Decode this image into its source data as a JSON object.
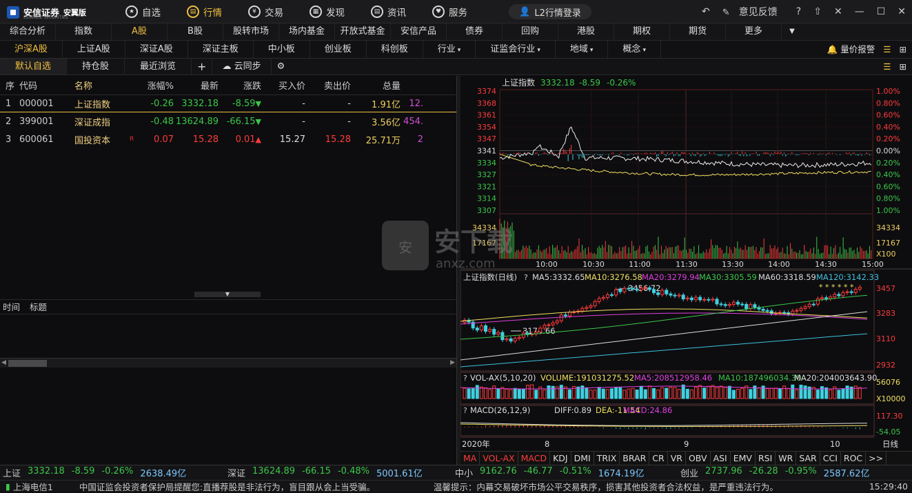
{
  "app": {
    "name": "安信证券",
    "sub": "ESSENCE SECURITIES",
    "edition": "安翼版"
  },
  "mainnav": [
    {
      "label": "自选",
      "icon": "★"
    },
    {
      "label": "行情",
      "icon": "▤",
      "active": true
    },
    {
      "label": "交易",
      "icon": "¥"
    },
    {
      "label": "发现",
      "icon": "▦"
    },
    {
      "label": "资讯",
      "icon": "▤"
    },
    {
      "label": "服务",
      "icon": "♥"
    }
  ],
  "l2_button": "L2行情登录",
  "window": {
    "feedback": "意见反馈"
  },
  "tabs1": [
    "综合分析",
    "指数",
    "A股",
    "B股",
    "股转市场",
    "场内基金",
    "开放式基金",
    "安信产品",
    "债券",
    "回购",
    "港股",
    "期权",
    "期货",
    "更多"
  ],
  "tabs2": [
    "沪深A股",
    "上证A股",
    "深证A股",
    "深证主板",
    "中小板",
    "创业板",
    "科创板",
    "行业",
    "证监会行业",
    "地域",
    "概念"
  ],
  "tabs2_alert": "量价报警",
  "tabs3": [
    "默认自选",
    "持仓股",
    "最近浏览"
  ],
  "tabs3_sync": "云同步",
  "table": {
    "headers": [
      "序",
      "代码",
      "名称",
      "涨幅%",
      "最新",
      "涨跌",
      "买入价",
      "卖出价",
      "总量"
    ],
    "rows": [
      {
        "seq": "1",
        "code": "000001",
        "name": "上证指数",
        "r": "",
        "pct": "-0.26",
        "last": "3332.18",
        "chg": "-8.59",
        "arrow": "▼",
        "bid": "-",
        "ask": "-",
        "vol": "1.91亿",
        "amt": "12.",
        "dir": "down"
      },
      {
        "seq": "2",
        "code": "399001",
        "name": "深证成指",
        "r": "",
        "pct": "-0.48",
        "last": "13624.89",
        "chg": "-66.15",
        "arrow": "▼",
        "bid": "-",
        "ask": "-",
        "vol": "3.56亿",
        "amt": "454.",
        "dir": "down"
      },
      {
        "seq": "3",
        "code": "600061",
        "name": "国投资本",
        "r": "R",
        "pct": "0.07",
        "last": "15.28",
        "chg": "0.01",
        "arrow": "▲",
        "bid": "15.27",
        "ask": "15.28",
        "vol": "25.71万",
        "amt": "2",
        "dir": "up"
      }
    ]
  },
  "news": {
    "time": "时间",
    "title": "标题"
  },
  "intraday": {
    "title": "上证指数",
    "last": "3332.18",
    "chg": "-8.59",
    "pct": "-0.26%",
    "price_ticks": [
      "3374",
      "3368",
      "3361",
      "3354",
      "3347",
      "3341",
      "3334",
      "3327",
      "3321",
      "3314",
      "3307"
    ],
    "pct_ticks": [
      "1.00%",
      "0.80%",
      "0.60%",
      "0.40%",
      "0.20%",
      "0.00%",
      "0.20%",
      "0.40%",
      "0.60%",
      "0.80%",
      "1.00%"
    ],
    "vol_ticks": [
      "34334",
      "17167",
      "X100"
    ],
    "vol_left": [
      "34334",
      "17167"
    ],
    "time_ticks": [
      "10:00",
      "10:30",
      "11:00",
      "11:30",
      "13:30",
      "14:00",
      "14:30",
      "15:00"
    ]
  },
  "kline": {
    "title": "上证指数(日线)",
    "ma5": "MA5:3332.65",
    "ma10": "MA10:3276.58",
    "ma20": "MA20:3279.94",
    "ma30": "MA30:3305.59",
    "ma60": "MA60:3318.59",
    "ma120": "MA120:3142.33",
    "high_label": "3456.72",
    "low_label": "3174.66",
    "ticks": [
      "3457",
      "3283",
      "3110",
      "2932"
    ],
    "stars": "* * * * * *"
  },
  "vol": {
    "title": "VOL-AX(5,10,20)",
    "volume": "VOLUME:191031275.52",
    "ma5": "MA5:208512958.46",
    "ma10": "MA10:187496034.30",
    "ma20": "MA20:204003643.90",
    "ticks": [
      "56076",
      "X10000"
    ]
  },
  "macd": {
    "title": "MACD(26,12,9)",
    "diff": "DIFF:0.89",
    "dea": "DEA:-11.54",
    "macd": "MACD:24.86",
    "ticks": [
      "117.30",
      "-54.05"
    ]
  },
  "date_axis": {
    "year": "2020年",
    "m8": "8",
    "m9": "9",
    "m10": "10",
    "period": "日线"
  },
  "indicators": [
    "MA",
    "VOL-AX",
    "MACD",
    "KDJ",
    "DMI",
    "TRIX",
    "BRAR",
    "CR",
    "VR",
    "OBV",
    "ASI",
    "EMV",
    "RSI",
    "WR",
    "SAR",
    "CCI",
    "ROC",
    ">>"
  ],
  "status": {
    "sh": {
      "n": "上证",
      "v": "3332.18",
      "c": "-8.59",
      "p": "-0.26%",
      "a": "2638.49亿"
    },
    "sz": {
      "n": "深证",
      "v": "13624.89",
      "c": "-66.15",
      "p": "-0.48%",
      "a": "5001.61亿"
    },
    "zx": {
      "n": "中小",
      "v": "9162.76",
      "c": "-46.77",
      "p": "-0.51%",
      "a": "1674.19亿"
    },
    "cy": {
      "n": "创业",
      "v": "2737.96",
      "c": "-26.28",
      "p": "-0.95%",
      "a": "2587.62亿"
    }
  },
  "bottom": {
    "conn": "上海电信1",
    "notice1": "中国证监会投资者保护局提醒您:直播荐股是非法行为，盲目跟从会上当受骗。",
    "notice2": "温馨提示：内幕交易破坏市场公平交易秩序，损害其他投资者合法权益，是严重违法行为。",
    "time": "15:29:40"
  },
  "watermark": {
    "big": "安下载",
    "small": "anxz.com"
  }
}
